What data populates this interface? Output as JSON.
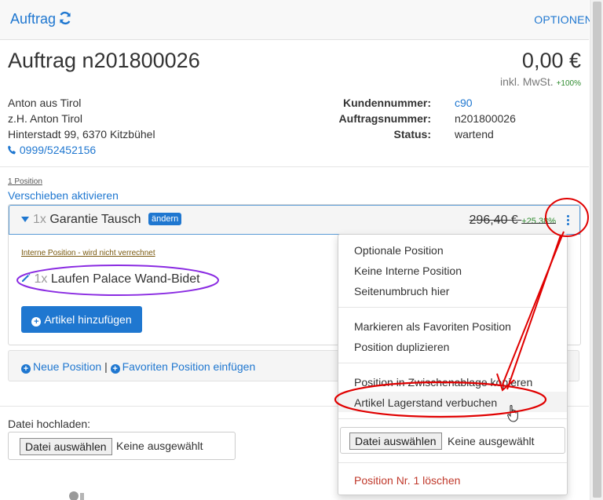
{
  "topbar": {
    "title": "Auftrag",
    "options": "OPTIONEN",
    "refresh_icon": "refresh-icon"
  },
  "order": {
    "title": "Auftrag n201800026",
    "amount": "0,00 €",
    "vat_label": "inkl. MwSt.",
    "vat_pct": "+100%"
  },
  "customer": {
    "name": "Anton aus Tirol",
    "contact": "z.H. Anton Tirol",
    "address": "Hinterstadt 99, 6370 Kitzbühel",
    "phone": "0999/52452156"
  },
  "meta": [
    {
      "label": "Kundennummer:",
      "value": "c90"
    },
    {
      "label": "Auftragsnummer:",
      "value": "n201800026"
    },
    {
      "label": "Status:",
      "value": "wartend"
    }
  ],
  "positions": {
    "count": "1 Position",
    "move_link": "Verschieben aktivieren"
  },
  "item": {
    "qty": "1x",
    "name": "Garantie Tausch",
    "badge": "ändern",
    "price": "296,40 €",
    "price_pct": "+25.38%",
    "internal_note": "Interne Position - wird nicht verrechnet",
    "sub_qty": "1x",
    "sub_name": "Laufen Palace Wand-Bidet",
    "add_button": "Artikel hinzufügen"
  },
  "footer": {
    "new_position": "Neue Position",
    "separator": "|",
    "favorite_position": "Favoriten Position einfügen"
  },
  "upload": {
    "label": "Datei hochladen:",
    "choose": "Datei auswählen",
    "none": "Keine ausgewählt"
  },
  "menu": {
    "items_a": [
      "Optionale Position",
      "Keine Interne Position",
      "Seitenumbruch hier"
    ],
    "items_b": [
      "Markieren als Favoriten Position",
      "Position duplizieren"
    ],
    "items_c": [
      "Position in Zwischenablage kopieren",
      "Artikel Lagerstand verbuchen"
    ],
    "choose": "Datei auswählen",
    "none": "Keine ausgewählt",
    "delete": "Position Nr. 1 löschen"
  },
  "colors": {
    "accent": "#1f77d0",
    "success": "#2e8b2e",
    "danger": "#c0392b",
    "annotation_red": "#e00000",
    "annotation_purple": "#8a2be2"
  }
}
